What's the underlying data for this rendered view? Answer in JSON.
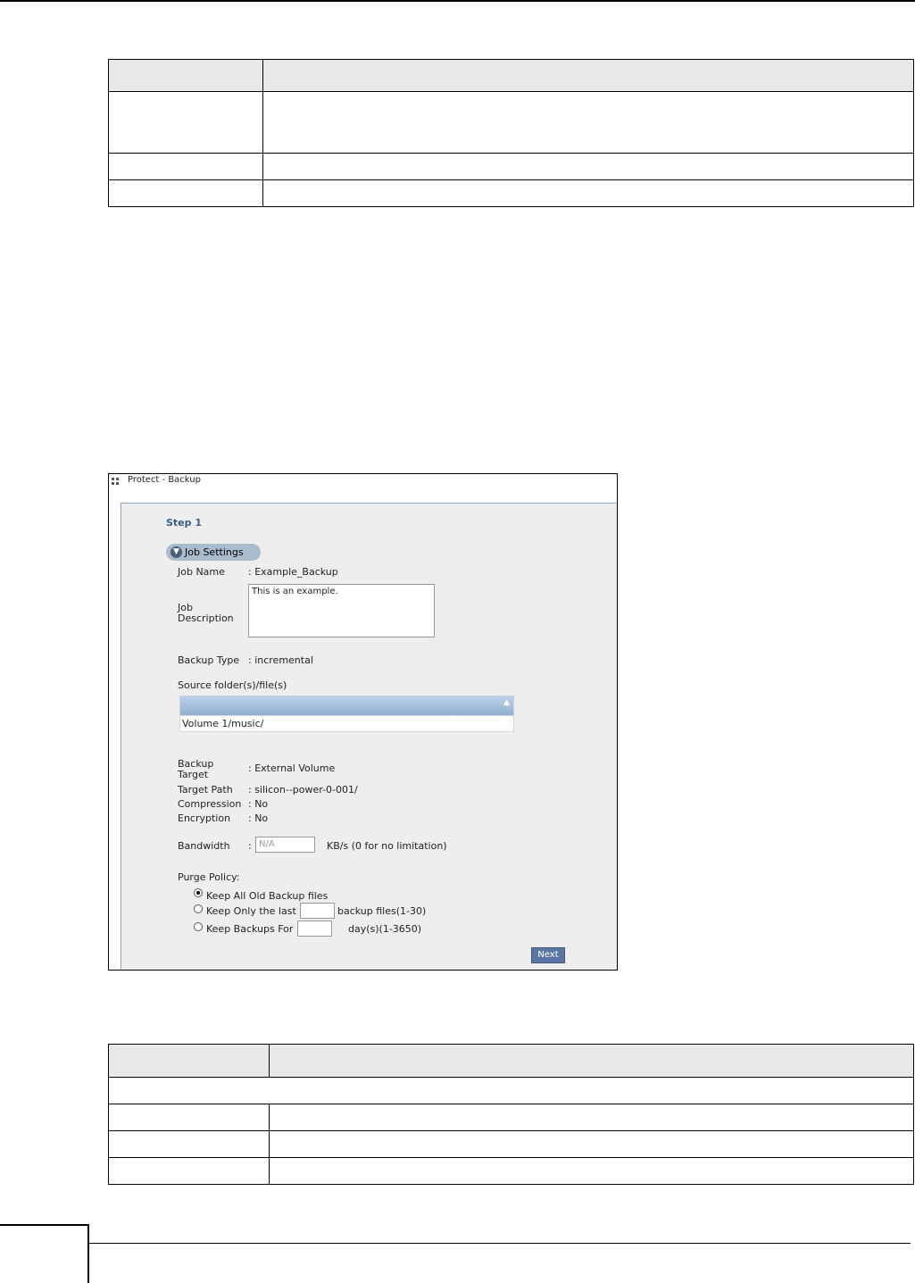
{
  "panel": {
    "title": "Protect - Backup",
    "step": "Step 1",
    "section": "Job Settings",
    "job_name_label": "Job Name",
    "job_name_value": ": Example_Backup",
    "job_desc_label_1": "Job",
    "job_desc_label_2": "Description",
    "job_desc_value": "This is an example.",
    "backup_type_label": "Backup Type",
    "backup_type_value": ": incremental",
    "source_label": "Source folder(s)/file(s)",
    "source_item": "Volume 1/music/",
    "target_label_1": "Backup",
    "target_label_2": "Target",
    "target_value": ": External Volume",
    "target_path_label": "Target Path",
    "target_path_value": ": silicon--power-0-001/",
    "compression_label": "Compression",
    "compression_value": ": No",
    "encryption_label": "Encryption",
    "encryption_value": ": No",
    "bandwidth_label": "Bandwidth",
    "bandwidth_colon": ":",
    "bandwidth_placeholder": "N/A",
    "bandwidth_unit": "KB/s (0 for no limitation)",
    "purge_label": "Purge Policy:",
    "purge_opt1": "Keep All Old Backup files",
    "purge_opt2": "Keep Only the last",
    "purge_opt2_suffix": "backup files(1-30)",
    "purge_opt3": "Keep Backups For",
    "purge_opt3_suffix": "day(s)(1-3650)",
    "next": "Next"
  }
}
